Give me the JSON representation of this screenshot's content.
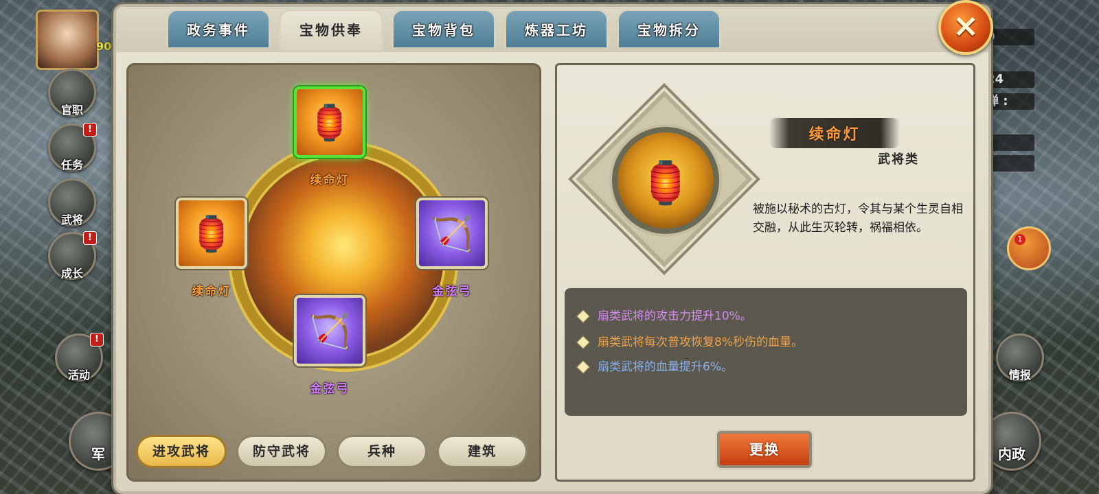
{
  "hud": {
    "level": "90",
    "left_buttons": [
      {
        "label": "官职",
        "badge": ""
      },
      {
        "label": "任务",
        "badge": "!"
      },
      {
        "label": "武将",
        "badge": ""
      },
      {
        "label": "成长",
        "badge": "!"
      },
      {
        "label": "活动",
        "badge": "!"
      }
    ],
    "left_bottom_label": "军",
    "right_stats": [
      "0",
      "24",
      "弹 :",
      ":",
      ":"
    ],
    "chat_count": "1",
    "right_buttons": [
      {
        "label": "情报"
      },
      {
        "label": "内政"
      }
    ]
  },
  "tabs": [
    {
      "label": "政务事件",
      "active": false
    },
    {
      "label": "宝物供奉",
      "active": true
    },
    {
      "label": "宝物背包",
      "active": false
    },
    {
      "label": "炼器工坊",
      "active": false
    },
    {
      "label": "宝物拆分",
      "active": false
    }
  ],
  "close_icon": "×",
  "altar": {
    "slots": [
      {
        "name": "续命灯",
        "icon": "lamp-icon",
        "glyph": "🏮",
        "rarity": "gold",
        "selected": true
      },
      {
        "name": "续命灯",
        "icon": "lamp-icon",
        "glyph": "🏮",
        "rarity": "gold",
        "selected": false
      },
      {
        "name": "金弦弓",
        "icon": "bow-icon",
        "glyph": "🏹",
        "rarity": "purple",
        "selected": false
      },
      {
        "name": "金弦弓",
        "icon": "bow-icon",
        "glyph": "🏹",
        "rarity": "purple",
        "selected": false
      }
    ],
    "category_buttons": [
      {
        "label": "进攻武将",
        "active": true
      },
      {
        "label": "防守武将",
        "active": false
      },
      {
        "label": "兵种",
        "active": false
      },
      {
        "label": "建筑",
        "active": false
      }
    ]
  },
  "detail": {
    "item_name": "续命灯",
    "item_icon": "🏮",
    "category": "武将类",
    "description": "被施以秘术的古灯，令其与某个生灵自相交融，从此生灭轮转，祸福相依。",
    "effects": [
      {
        "text": "扇类武将的攻击力提升10%。",
        "color": "#d48cf0"
      },
      {
        "text": "扇类武将每次普攻恢复8%秒伤的血量。",
        "color": "#f0a24a"
      },
      {
        "text": "扇类武将的血量提升6%。",
        "color": "#8ab0f0"
      }
    ],
    "replace_label": "更换"
  }
}
